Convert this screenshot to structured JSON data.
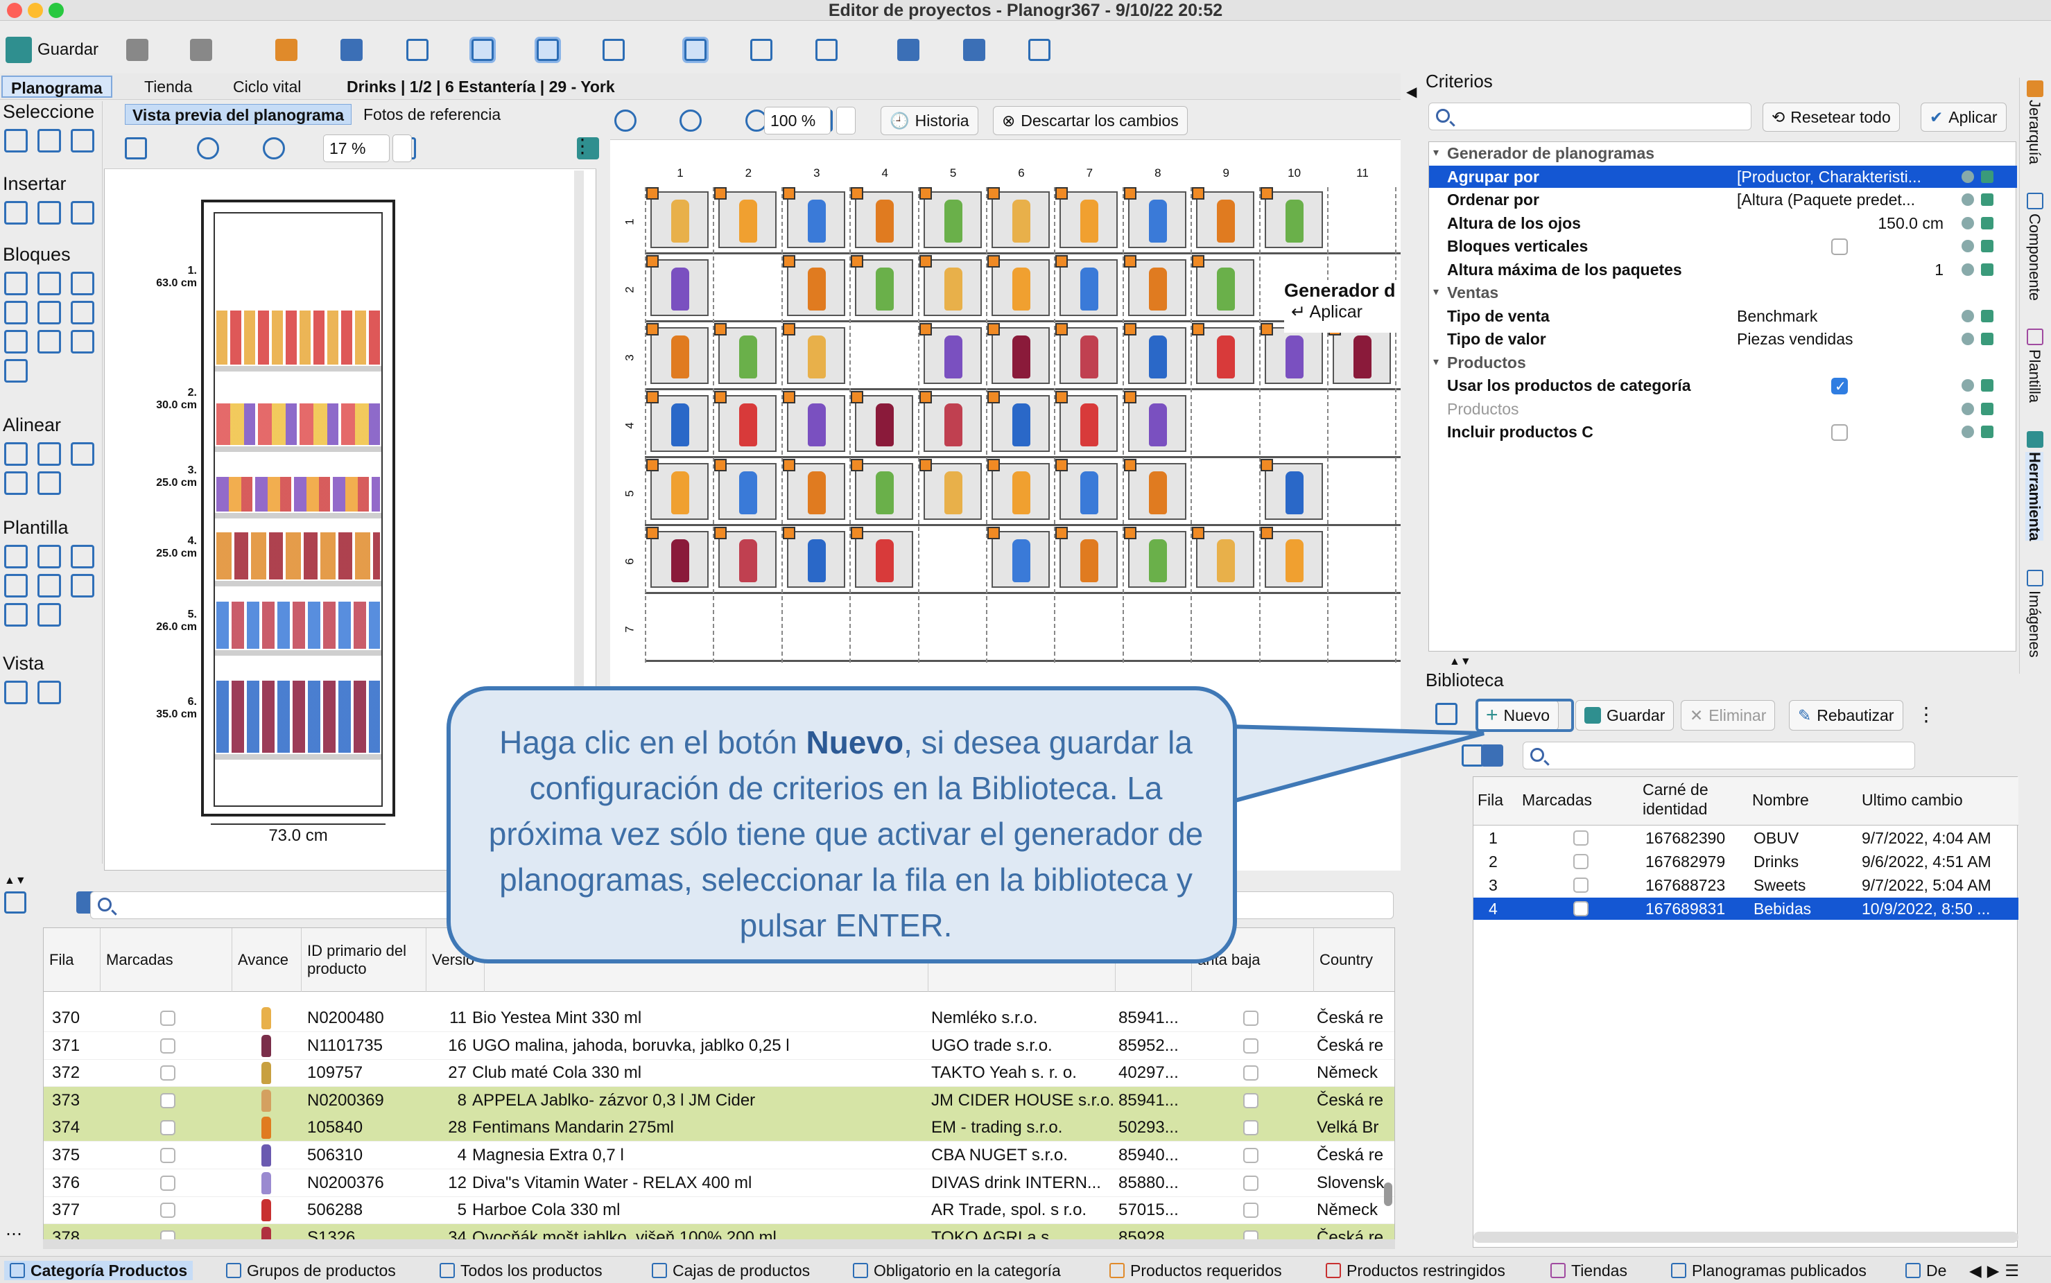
{
  "window": {
    "title": "Editor de proyectos - Planogr367 - 9/10/22 20:52"
  },
  "toolbar": {
    "save": "Guardar"
  },
  "tabs": [
    "Planograma",
    "Tienda",
    "Ciclo vital"
  ],
  "breadcrumb": "Drinks | 1/2 | 6 Estantería | 29 - York",
  "left_palette": {
    "select": "Seleccione",
    "insert": "Insertar",
    "blocks": "Bloques",
    "align": "Alinear",
    "template": "Plantilla",
    "view": "Vista"
  },
  "preview": {
    "tab_active": "Vista previa del planograma",
    "tab_other": "Fotos de referencia",
    "zoom": "17 %",
    "width_label": "73.0 cm",
    "shelves": [
      {
        "n": "1.",
        "h": "63.0 cm"
      },
      {
        "n": "2.",
        "h": "30.0 cm"
      },
      {
        "n": "3.",
        "h": "25.0 cm"
      },
      {
        "n": "4.",
        "h": "25.0 cm"
      },
      {
        "n": "5.",
        "h": "26.0 cm"
      },
      {
        "n": "6.",
        "h": "35.0 cm"
      }
    ]
  },
  "planogram": {
    "zoom": "100 %",
    "history": "Historia",
    "discard": "Descartar los cambios",
    "columns": [
      "1",
      "2",
      "3",
      "4",
      "5",
      "6",
      "7",
      "8",
      "9",
      "10",
      "11"
    ],
    "rows": [
      "1",
      "2",
      "3",
      "4",
      "5",
      "6",
      "7"
    ],
    "popup_title": "Generador d",
    "popup_apply": "↵ Aplicar"
  },
  "criteria": {
    "title": "Criterios",
    "reset": "Resetear todo",
    "apply": "Aplicar",
    "rows": [
      {
        "type": "cat",
        "key": "Generador de planogramas"
      },
      {
        "type": "prop",
        "key": "Agrupar por",
        "val": "[Productor, Charakteristi...",
        "selected": true
      },
      {
        "type": "prop",
        "key": "Ordenar por",
        "val": "[Altura (Paquete predet..."
      },
      {
        "type": "prop",
        "key": "Altura de los ojos",
        "val": "150.0 cm"
      },
      {
        "type": "prop",
        "key": "Bloques verticales",
        "val": ""
      },
      {
        "type": "prop",
        "key": "Altura máxima de los paquetes",
        "val": "1"
      },
      {
        "type": "cat",
        "key": "Ventas"
      },
      {
        "type": "prop",
        "key": "Tipo de venta",
        "val": "Benchmark"
      },
      {
        "type": "prop",
        "key": "Tipo de valor",
        "val": "Piezas vendidas"
      },
      {
        "type": "cat",
        "key": "Productos"
      },
      {
        "type": "prop",
        "key": "Usar los productos de categoría",
        "val": ""
      },
      {
        "type": "sub",
        "key": "Productos",
        "val": ""
      },
      {
        "type": "prop",
        "key": "Incluir productos C",
        "val": ""
      }
    ]
  },
  "right_strip": [
    "Jerarquía",
    "Componente",
    "Plantilla",
    "Herramienta",
    "Imágenes"
  ],
  "library": {
    "title": "Biblioteca",
    "new": "Nuevo",
    "save": "Guardar",
    "delete": "Eliminar",
    "rebuild": "Rebautizar",
    "headers": [
      "Fila",
      "Marcadas",
      "Carné de identidad",
      "Nombre",
      "Ultimo cambio"
    ],
    "rows": [
      {
        "fila": "1",
        "id": "167682390",
        "name": "OBUV",
        "date": "9/7/2022, 4:04 AM"
      },
      {
        "fila": "2",
        "id": "167682979",
        "name": "Drinks",
        "date": "9/6/2022, 4:51 AM"
      },
      {
        "fila": "3",
        "id": "167688723",
        "name": "Sweets",
        "date": "9/7/2022, 5:04 AM"
      },
      {
        "fila": "4",
        "id": "167689831",
        "name": "Bebidas",
        "date": "10/9/2022, 8:50 ..."
      }
    ]
  },
  "grid": {
    "headers": [
      "Fila",
      "Marcadas",
      "Avance",
      "ID primario del producto",
      "Versió",
      "",
      "",
      "",
      "anta baja",
      "Country"
    ],
    "rows": [
      {
        "fila": "370",
        "id": "N0200480",
        "ver": "11",
        "name": "Bio Yestea Mint 330 ml",
        "supp": "Nemléko s.r.o.",
        "ean": "85941...",
        "country": "Česká re",
        "hl": false,
        "c": "#e8b04a"
      },
      {
        "fila": "371",
        "id": "N1101735",
        "ver": "16",
        "name": "UGO malina, jahoda, boruvka, jablko 0,25 l",
        "supp": "UGO trade s.r.o.",
        "ean": "85952...",
        "country": "Česká re",
        "hl": false,
        "c": "#7a2e4a"
      },
      {
        "fila": "372",
        "id": "109757",
        "ver": "27",
        "name": "Club maté Cola 330 ml",
        "supp": "TAKTO Yeah s. r. o.",
        "ean": "40297...",
        "country": "Německ",
        "hl": false,
        "c": "#c8a040"
      },
      {
        "fila": "373",
        "id": "N0200369",
        "ver": "8",
        "name": "APPELA Jablko- zázvor 0,3 l JM Cider",
        "supp": "JM CIDER HOUSE s.r.o.",
        "ean": "85941...",
        "country": "Česká re",
        "hl": true,
        "c": "#d4a060"
      },
      {
        "fila": "374",
        "id": "105840",
        "ver": "28",
        "name": "Fentimans Mandarin 275ml",
        "supp": "EM - trading s.r.o.",
        "ean": "50293...",
        "country": "Velká Br",
        "hl": true,
        "c": "#e07b20"
      },
      {
        "fila": "375",
        "id": "506310",
        "ver": "4",
        "name": "Magnesia Extra 0,7 l",
        "supp": "CBA NUGET s.r.o.",
        "ean": "85940...",
        "country": "Česká re",
        "hl": false,
        "c": "#6a5ab0"
      },
      {
        "fila": "376",
        "id": "N0200376",
        "ver": "12",
        "name": "Diva\"s Vitamin Water - RELAX 400 ml",
        "supp": "DIVAS drink INTERN...",
        "ean": "85880...",
        "country": "Slovensk",
        "hl": false,
        "c": "#9a8ad0"
      },
      {
        "fila": "377",
        "id": "506288",
        "ver": "5",
        "name": "Harboe Cola 330 ml",
        "supp": "AR Trade, spol. s r.o.",
        "ean": "57015...",
        "country": "Německ",
        "hl": false,
        "c": "#c83030"
      },
      {
        "fila": "378",
        "id": "S1326",
        "ver": "34",
        "name": "Ovocňák mošt jablko, višeň 100% 200 ml",
        "supp": "TOKO AGRI a.s.",
        "ean": "85928...",
        "country": "Česká re",
        "hl": true,
        "c": "#b03040"
      }
    ]
  },
  "bottom_tabs": [
    "Categoría Productos",
    "Grupos de productos",
    "Todos los productos",
    "Cajas de productos",
    "Obligatorio en la categoría",
    "Productos requeridos",
    "Productos restringidos",
    "Tiendas",
    "Planogramas publicados",
    "De"
  ],
  "callout": {
    "part1": "Haga clic en el botón ",
    "bold": "Nuevo",
    "part2": ", si desea guardar la configuración de criterios en la Biblioteca. La próxima vez sólo tiene que activar el generador de planogramas, seleccionar la fila en la biblioteca y pulsar ENTER."
  },
  "colors": {
    "accent": "#1457d3",
    "callout_border": "#3f78b6",
    "highlight_row": "#d6e4a6",
    "handle": "#f08a24"
  }
}
